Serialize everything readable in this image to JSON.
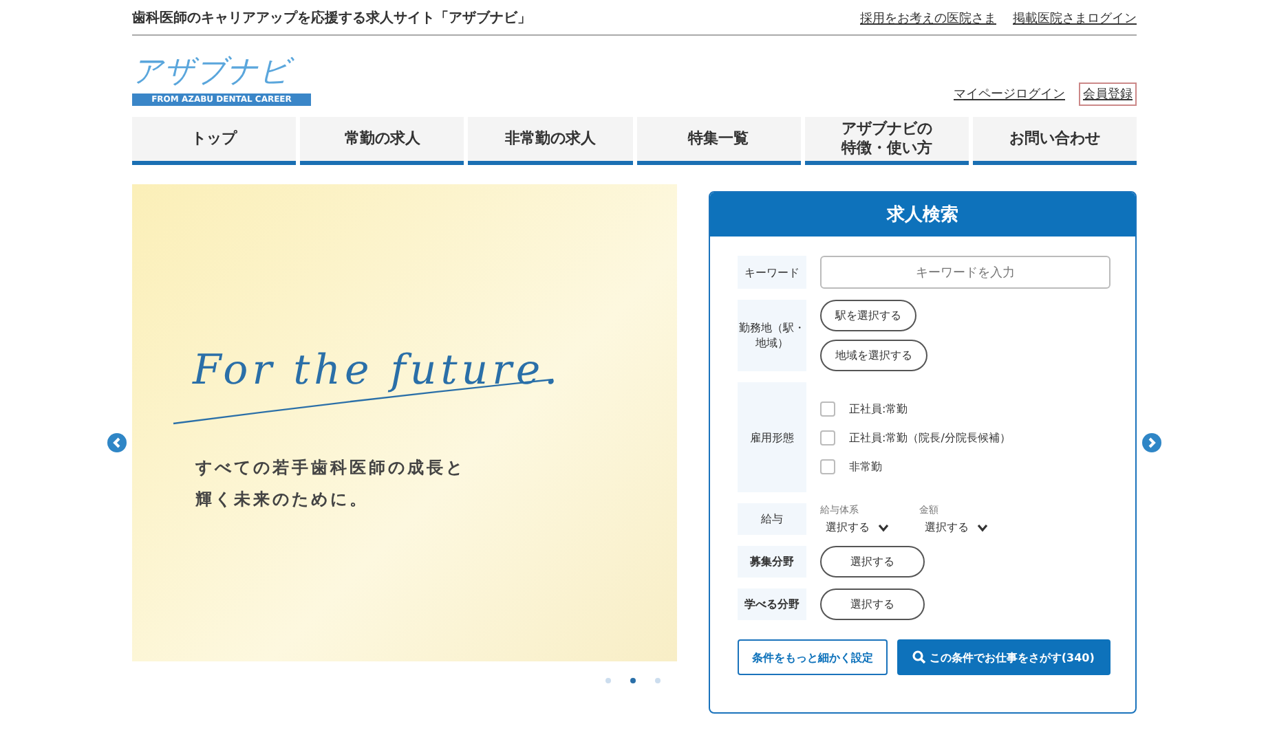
{
  "header": {
    "tagline": "歯科医師のキャリアアップを応援する求人サイト「アザブナビ」",
    "links": [
      "採用をお考えの医院さま",
      "掲載医院さまログイン"
    ]
  },
  "logo": {
    "text": "アザブナビ",
    "subtitle": "FROM AZABU DENTAL CAREER"
  },
  "account_links": [
    {
      "label": "マイページログイン",
      "kind": "link"
    },
    {
      "label": "会員登録",
      "kind": "boxed"
    }
  ],
  "nav": [
    {
      "lines": [
        "トップ"
      ]
    },
    {
      "lines": [
        "常勤の求人"
      ]
    },
    {
      "lines": [
        "非常勤の求人"
      ]
    },
    {
      "lines": [
        "特集一覧"
      ]
    },
    {
      "lines": [
        "アザブナビの",
        "特徴・使い方"
      ]
    },
    {
      "lines": [
        "お問い合わせ"
      ]
    }
  ],
  "hero": {
    "script_title": "For the future.",
    "lines": [
      "すべての若手歯科医師の成長と",
      "輝く未来のために。"
    ],
    "dots": [
      {
        "selected": false
      },
      {
        "selected": true
      },
      {
        "selected": false
      }
    ]
  },
  "search": {
    "title": "求人検索",
    "keyword": {
      "label": "キーワード",
      "placeholder": "キーワードを入力"
    },
    "location": {
      "label": "勤務地（駅・地域）",
      "buttons": [
        "駅を選択する",
        "地域を選択する"
      ]
    },
    "employment": {
      "label": "雇用形態",
      "options": [
        {
          "label": "正社員:常勤",
          "checked": false
        },
        {
          "label": "正社員:常勤（院長/分院長候補）",
          "checked": false
        },
        {
          "label": "非常勤",
          "checked": false
        }
      ]
    },
    "salary": {
      "label": "給与",
      "selects": [
        {
          "caption": "給与体系",
          "value": "選択する"
        },
        {
          "caption": "金額",
          "value": "選択する"
        }
      ]
    },
    "rows": [
      {
        "label": "募集分野",
        "button": "選択する"
      },
      {
        "label": "学べる分野",
        "button": "選択する"
      }
    ],
    "detail_button": "条件をもっと細かく設定",
    "submit_button": "この条件でお仕事をさがす(340)"
  }
}
